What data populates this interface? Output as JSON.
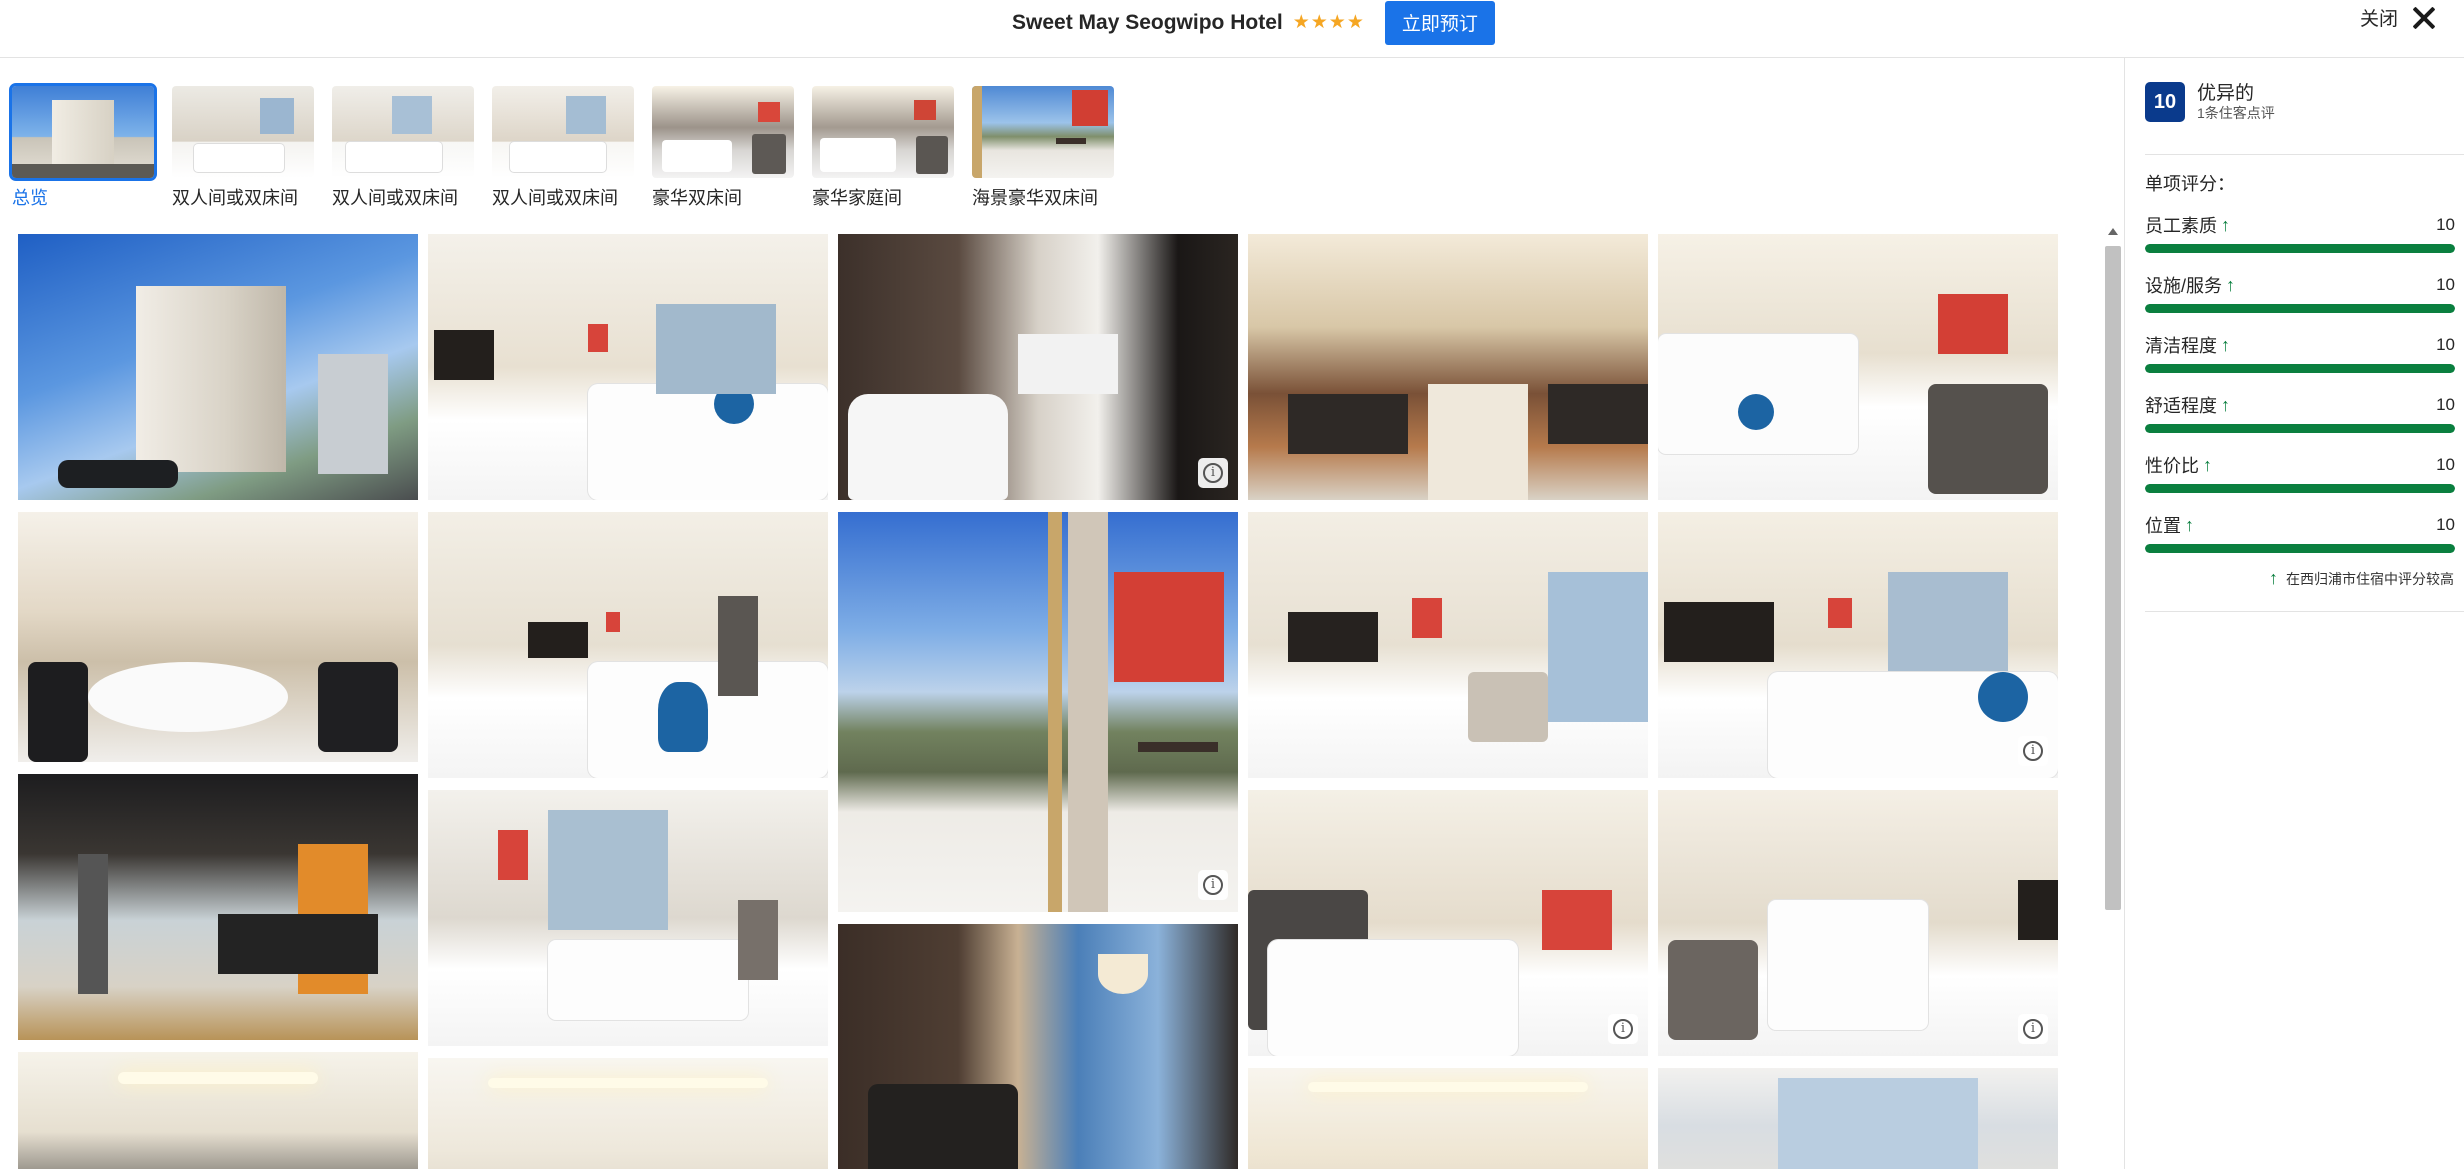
{
  "header": {
    "hotel_name": "Sweet May Seogwipo Hotel",
    "stars": "★★★★",
    "book_label": "立即预订",
    "close_label": "关闭"
  },
  "thumbnails": [
    {
      "label": "总览",
      "active": true
    },
    {
      "label": "双人间或双床间"
    },
    {
      "label": "双人间或双床间"
    },
    {
      "label": "双人间或双床间"
    },
    {
      "label": "豪华双床间"
    },
    {
      "label": "豪华家庭间"
    },
    {
      "label": "海景豪华双床间"
    }
  ],
  "review": {
    "score": "10",
    "word": "优异的",
    "count": "1条住客点评",
    "sub_title": "单项评分：",
    "ratings": [
      {
        "label": "员工素质",
        "value": "10",
        "fill": 1.0
      },
      {
        "label": "设施/服务",
        "value": "10",
        "fill": 1.0
      },
      {
        "label": "清洁程度",
        "value": "10",
        "fill": 1.0
      },
      {
        "label": "舒适程度",
        "value": "10",
        "fill": 1.0
      },
      {
        "label": "性价比",
        "value": "10",
        "fill": 1.0
      },
      {
        "label": "位置",
        "value": "10",
        "fill": 1.0
      }
    ],
    "note": "在西归浦市住宿中评分较高"
  },
  "colors": {
    "accent": "#1a73e8",
    "score_badge": "#0a3a8c",
    "rating_green": "#0a7f3f",
    "star_gold": "#f5a623"
  },
  "icons": {
    "close": "close-icon",
    "info": "info-icon",
    "up_arrow": "arrow-up-icon"
  }
}
